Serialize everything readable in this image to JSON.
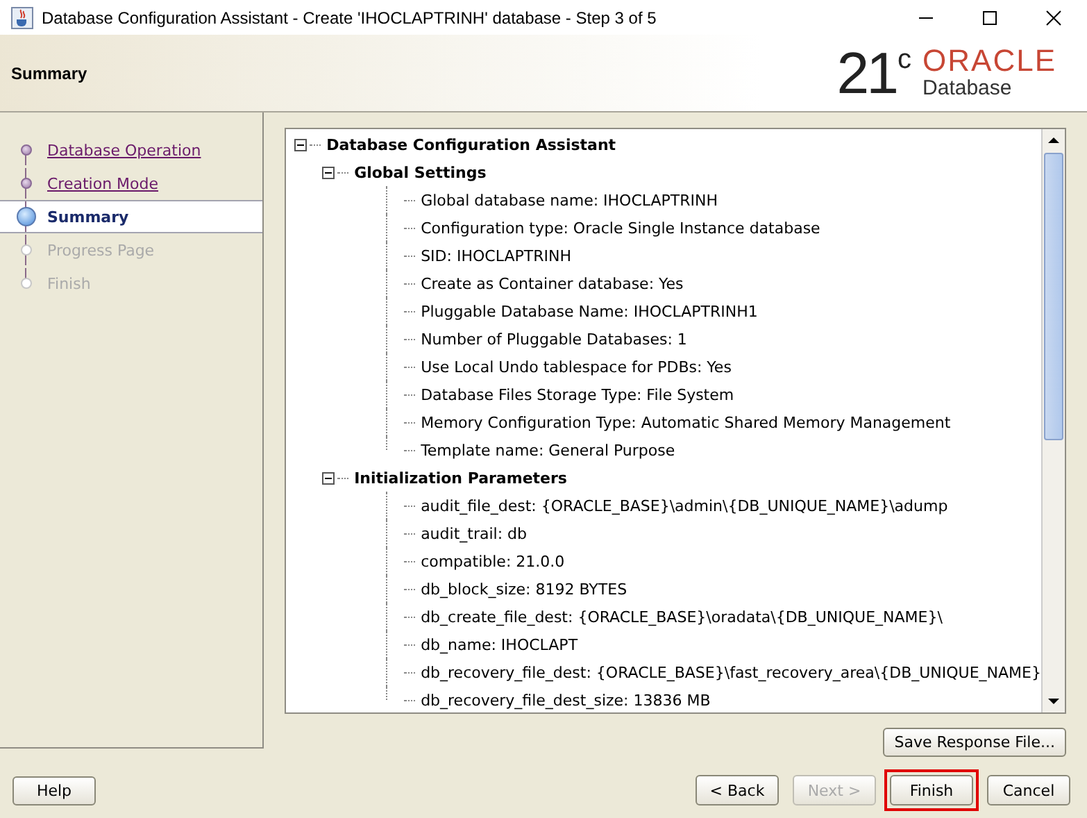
{
  "window": {
    "title": "Database Configuration Assistant - Create 'IHOCLAPTRINH' database - Step 3 of 5"
  },
  "header": {
    "title": "Summary",
    "logo": {
      "version": "21",
      "superscript": "c",
      "brand": "ORACLE",
      "product": "Database"
    }
  },
  "steps": [
    {
      "label": "Database Operation",
      "done": true,
      "selected": false
    },
    {
      "label": "Creation Mode",
      "done": true,
      "selected": false
    },
    {
      "label": "Summary",
      "done": false,
      "selected": true
    },
    {
      "label": "Progress Page",
      "done": false,
      "selected": false
    },
    {
      "label": "Finish",
      "done": false,
      "selected": false
    }
  ],
  "tree": [
    {
      "label": "Database Configuration Assistant",
      "expanded": true,
      "children": [
        {
          "label": "Global Settings",
          "expanded": true,
          "children": [
            {
              "label": "Global database name: IHOCLAPTRINH"
            },
            {
              "label": "Configuration type: Oracle Single Instance database"
            },
            {
              "label": "SID: IHOCLAPTRINH"
            },
            {
              "label": "Create as Container database: Yes"
            },
            {
              "label": "Pluggable Database Name: IHOCLAPTRINH1"
            },
            {
              "label": "Number of Pluggable Databases: 1"
            },
            {
              "label": "Use Local Undo tablespace for PDBs: Yes"
            },
            {
              "label": "Database Files Storage Type: File System"
            },
            {
              "label": "Memory Configuration Type: Automatic Shared Memory Management"
            },
            {
              "label": "Template name: General Purpose"
            }
          ]
        },
        {
          "label": "Initialization Parameters",
          "expanded": true,
          "children": [
            {
              "label": "audit_file_dest: {ORACLE_BASE}\\admin\\{DB_UNIQUE_NAME}\\adump"
            },
            {
              "label": "audit_trail: db"
            },
            {
              "label": "compatible: 21.0.0"
            },
            {
              "label": "db_block_size: 8192 BYTES"
            },
            {
              "label": "db_create_file_dest: {ORACLE_BASE}\\oradata\\{DB_UNIQUE_NAME}\\"
            },
            {
              "label": "db_name: IHOCLAPT"
            },
            {
              "label": "db_recovery_file_dest: {ORACLE_BASE}\\fast_recovery_area\\{DB_UNIQUE_NAME}"
            },
            {
              "label": "db_recovery_file_dest_size: 13836 MB"
            }
          ]
        }
      ]
    }
  ],
  "save_button": {
    "label": "Save Response File..."
  },
  "help_button": {
    "label": "Help"
  },
  "buttons": [
    {
      "label": "< Back",
      "disabled": false,
      "highlighted": false
    },
    {
      "label": "Next >",
      "disabled": true,
      "highlighted": false
    },
    {
      "label": "Finish",
      "disabled": false,
      "highlighted": true
    },
    {
      "label": "Cancel",
      "disabled": false,
      "highlighted": false
    }
  ]
}
